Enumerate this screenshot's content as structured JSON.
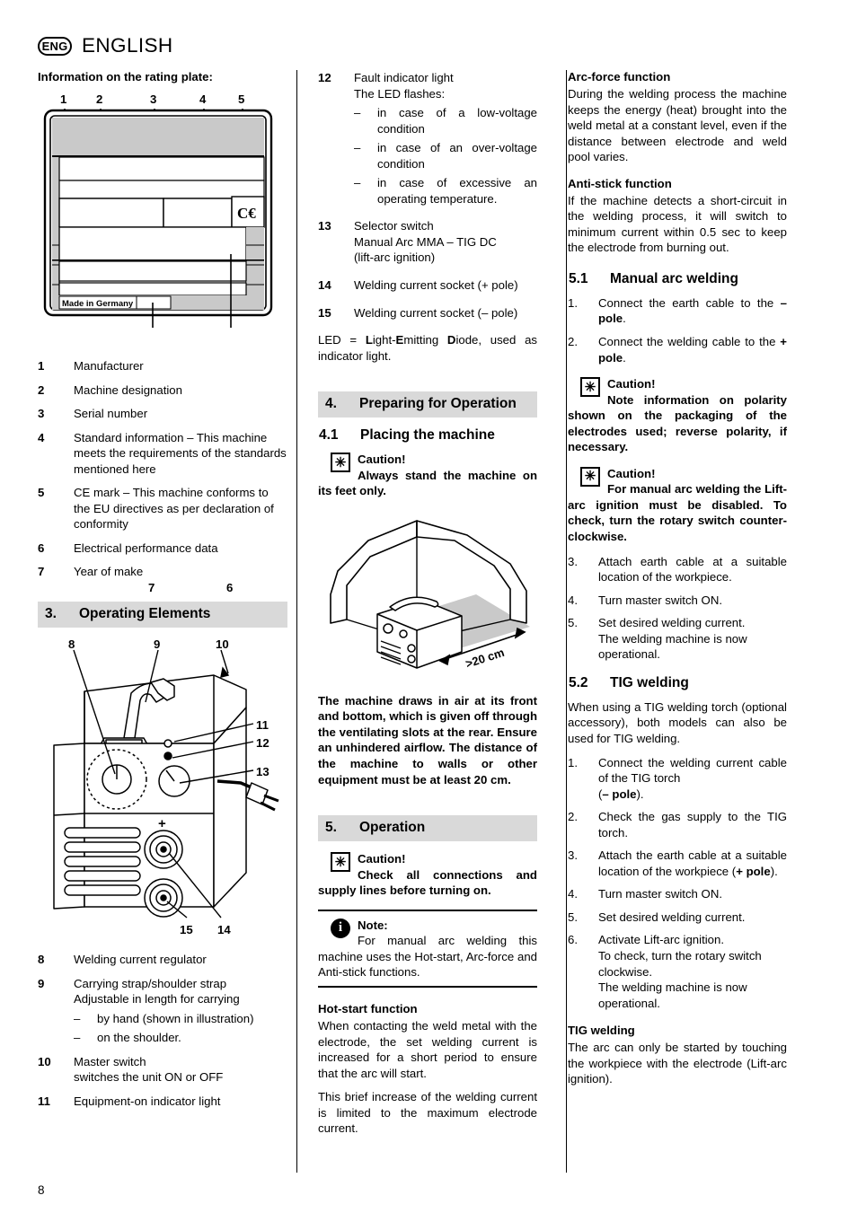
{
  "header": {
    "badge": "ENG",
    "title": "ENGLISH"
  },
  "page_number": "8",
  "col1": {
    "rating_heading": "Information on the rating plate:",
    "plate_figure": {
      "name": "rating-plate-diagram",
      "top_callouts": [
        "1",
        "2",
        "3",
        "4",
        "5"
      ],
      "bottom_callouts": [
        "7",
        "6"
      ],
      "made_in": "Made in Germany",
      "ce_mark": "CE"
    },
    "items": [
      {
        "num": "1",
        "text": "Manufacturer"
      },
      {
        "num": "2",
        "text": "Machine designation"
      },
      {
        "num": "3",
        "text": "Serial number"
      },
      {
        "num": "4",
        "text": "Standard information – This machine meets the requirements of the standards mentioned here"
      },
      {
        "num": "5",
        "text": "CE mark – This machine conforms to the EU directives as per declaration of conformity"
      },
      {
        "num": "6",
        "text": "Electrical performance data"
      },
      {
        "num": "7",
        "text": "Year of make"
      }
    ],
    "section3": {
      "num": "3.",
      "title": "Operating Elements"
    },
    "machine_figure": {
      "name": "machine-front-view-diagram",
      "callouts": [
        "8",
        "9",
        "10",
        "11",
        "12",
        "13",
        "14",
        "15"
      ]
    },
    "items2": [
      {
        "num": "8",
        "text": "Welding current regulator"
      },
      {
        "num": "9",
        "text": "Carrying strap/shoulder strap\nAdjustable in length for carrying",
        "dashes": [
          "by hand (shown in illustration)",
          "on the shoulder."
        ]
      },
      {
        "num": "10",
        "text": "Master switch\nswitches the unit ON or OFF"
      },
      {
        "num": "11",
        "text": "Equipment-on indicator light"
      }
    ]
  },
  "col2": {
    "items": [
      {
        "num": "12",
        "text": "Fault indicator light\nThe LED flashes:",
        "dashes": [
          "in case of a low-voltage condition",
          "in case of an over-voltage condition",
          "in case of excessive an operating temperature."
        ]
      },
      {
        "num": "13",
        "text": "Selector switch\nManual Arc MMA – TIG DC\n(lift-arc ignition)"
      },
      {
        "num": "14",
        "text": "Welding current socket (+ pole)"
      },
      {
        "num": "15",
        "text": "Welding current socket (– pole)"
      }
    ],
    "led_note_parts": {
      "p1": "LED = ",
      "b1": "L",
      "p2": "ight-",
      "b2": "E",
      "p3": "mitting ",
      "b3": "D",
      "p4": "iode, used as indicator light."
    },
    "section4": {
      "num": "4.",
      "title": "Preparing for Operation"
    },
    "subsection41": {
      "num": "4.1",
      "title": "Placing the machine"
    },
    "caution1": {
      "icon": "caution-starburst-icon",
      "title": "Caution!",
      "body": "Always stand the machine on its feet only."
    },
    "air_figure": {
      "name": "machine-clearance-diagram",
      "label": ">20 cm"
    },
    "airflow_text": "The machine draws in air at its front and bottom, which is given off through the ventilating slots at the rear. Ensure an unhindered airflow. The distance of the machine to walls or other equipment must be at least 20 cm.",
    "section5": {
      "num": "5.",
      "title": "Operation"
    },
    "caution2": {
      "icon": "caution-starburst-icon",
      "title": "Caution!",
      "body": "Check all connections and supply lines before turning on."
    },
    "note1": {
      "icon": "info-circle-icon",
      "title": "Note:",
      "body": "For manual arc welding this machine uses the Hot-start, Arc-force and Anti-stick functions."
    },
    "hotstart_heading": "Hot-start function",
    "hotstart_p1": "When contacting the weld metal with the electrode, the set welding current is increased for a short period to ensure that the arc will start.",
    "hotstart_p2": "This brief increase of the welding current is limited to the maximum electrode current."
  },
  "col3": {
    "arcforce_heading": "Arc-force function",
    "arcforce_body": "During the welding process the machine keeps the energy (heat) brought into the weld metal at a constant level, even if the distance between electrode and weld pool varies.",
    "antistick_heading": "Anti-stick function",
    "antistick_body": "If the machine detects a short-circuit in the welding process, it will switch to minimum current within 0.5 sec to keep the electrode from burning out.",
    "subsection51": {
      "num": "5.1",
      "title": "Manual arc welding"
    },
    "mma_step1": {
      "num": "1.",
      "pre": "Connect the earth cable to the ",
      "bold": "– pole",
      "post": "."
    },
    "mma_step2": {
      "num": "2.",
      "pre": "Connect the welding cable to the ",
      "bold": "+ pole",
      "post": "."
    },
    "caution3": {
      "icon": "caution-starburst-icon",
      "title": "Caution!",
      "body": "Note information on polarity shown on the packaging of the electrodes used; reverse polarity, if necessary."
    },
    "caution4": {
      "icon": "caution-starburst-icon",
      "title": "Caution!",
      "body": "For manual arc welding the Lift-arc ignition must be disabled. To check, turn the rotary switch counter-clockwise."
    },
    "mma_steps_rest": [
      {
        "num": "3.",
        "text": "Attach earth cable at a suitable location of the workpiece."
      },
      {
        "num": "4.",
        "text": "Turn master switch ON."
      },
      {
        "num": "5.",
        "text": "Set desired welding current.\nThe welding machine is now operational."
      }
    ],
    "subsection52": {
      "num": "5.2",
      "title": "TIG welding"
    },
    "tig_intro": "When using a TIG welding torch (optional accessory), both models can also be used for TIG welding.",
    "tig_step1": {
      "num": "1.",
      "pre": "Connect the welding current cable of the TIG torch",
      "line2_pre": "(",
      "bold": "– pole",
      "line2_post": ")."
    },
    "tig_step2": {
      "num": "2.",
      "text": "Check the gas supply to the TIG torch."
    },
    "tig_step3": {
      "num": "3.",
      "pre": "Attach the earth cable at a suitable location of the workpiece (",
      "bold": "+ pole",
      "post": ")."
    },
    "tig_steps_rest": [
      {
        "num": "4.",
        "text": "Turn master switch ON."
      },
      {
        "num": "5.",
        "text": "Set desired welding current."
      },
      {
        "num": "6.",
        "text": "Activate Lift-arc ignition.\nTo check, turn the rotary switch clockwise.\nThe welding machine is now operational."
      }
    ],
    "tig_heading": "TIG welding",
    "tig_body": "The arc can only be started by touching the workpiece with the electrode (Lift-arc ignition)."
  }
}
